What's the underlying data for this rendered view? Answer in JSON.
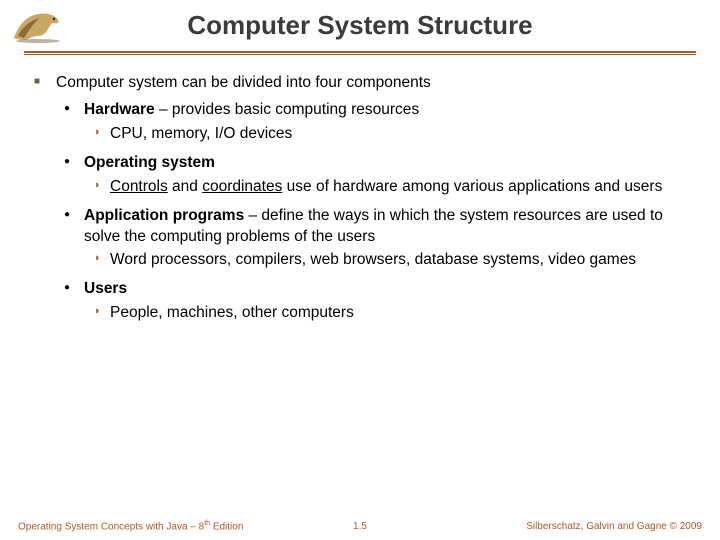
{
  "title": "Computer System Structure",
  "main": {
    "intro": "Computer system can be divided into four components",
    "items": [
      {
        "head_a": "Hardware",
        "head_b": " – provides basic computing resources",
        "subs": [
          "CPU, memory, I/O devices"
        ]
      },
      {
        "head_a": "Operating system",
        "head_b": "",
        "subs_rich": {
          "pre": "",
          "u1": "Controls",
          "mid": " and ",
          "u2": "coordinates",
          "post": " use of hardware among various applications and users"
        }
      },
      {
        "head_a": "Application programs",
        "head_b": " – define the ways in which the system resources are used to solve the computing problems of the users",
        "subs": [
          "Word processors, compilers, web browsers, database systems, video games"
        ]
      },
      {
        "head_a": "Users",
        "head_b": "",
        "subs": [
          "People, machines, other computers"
        ]
      }
    ]
  },
  "footer": {
    "left_a": "Operating System Concepts with Java – 8",
    "left_sup": "th",
    "left_b": " Edition",
    "center": "1.5",
    "right": "Silberschatz, Galvin and Gagne © 2009"
  }
}
